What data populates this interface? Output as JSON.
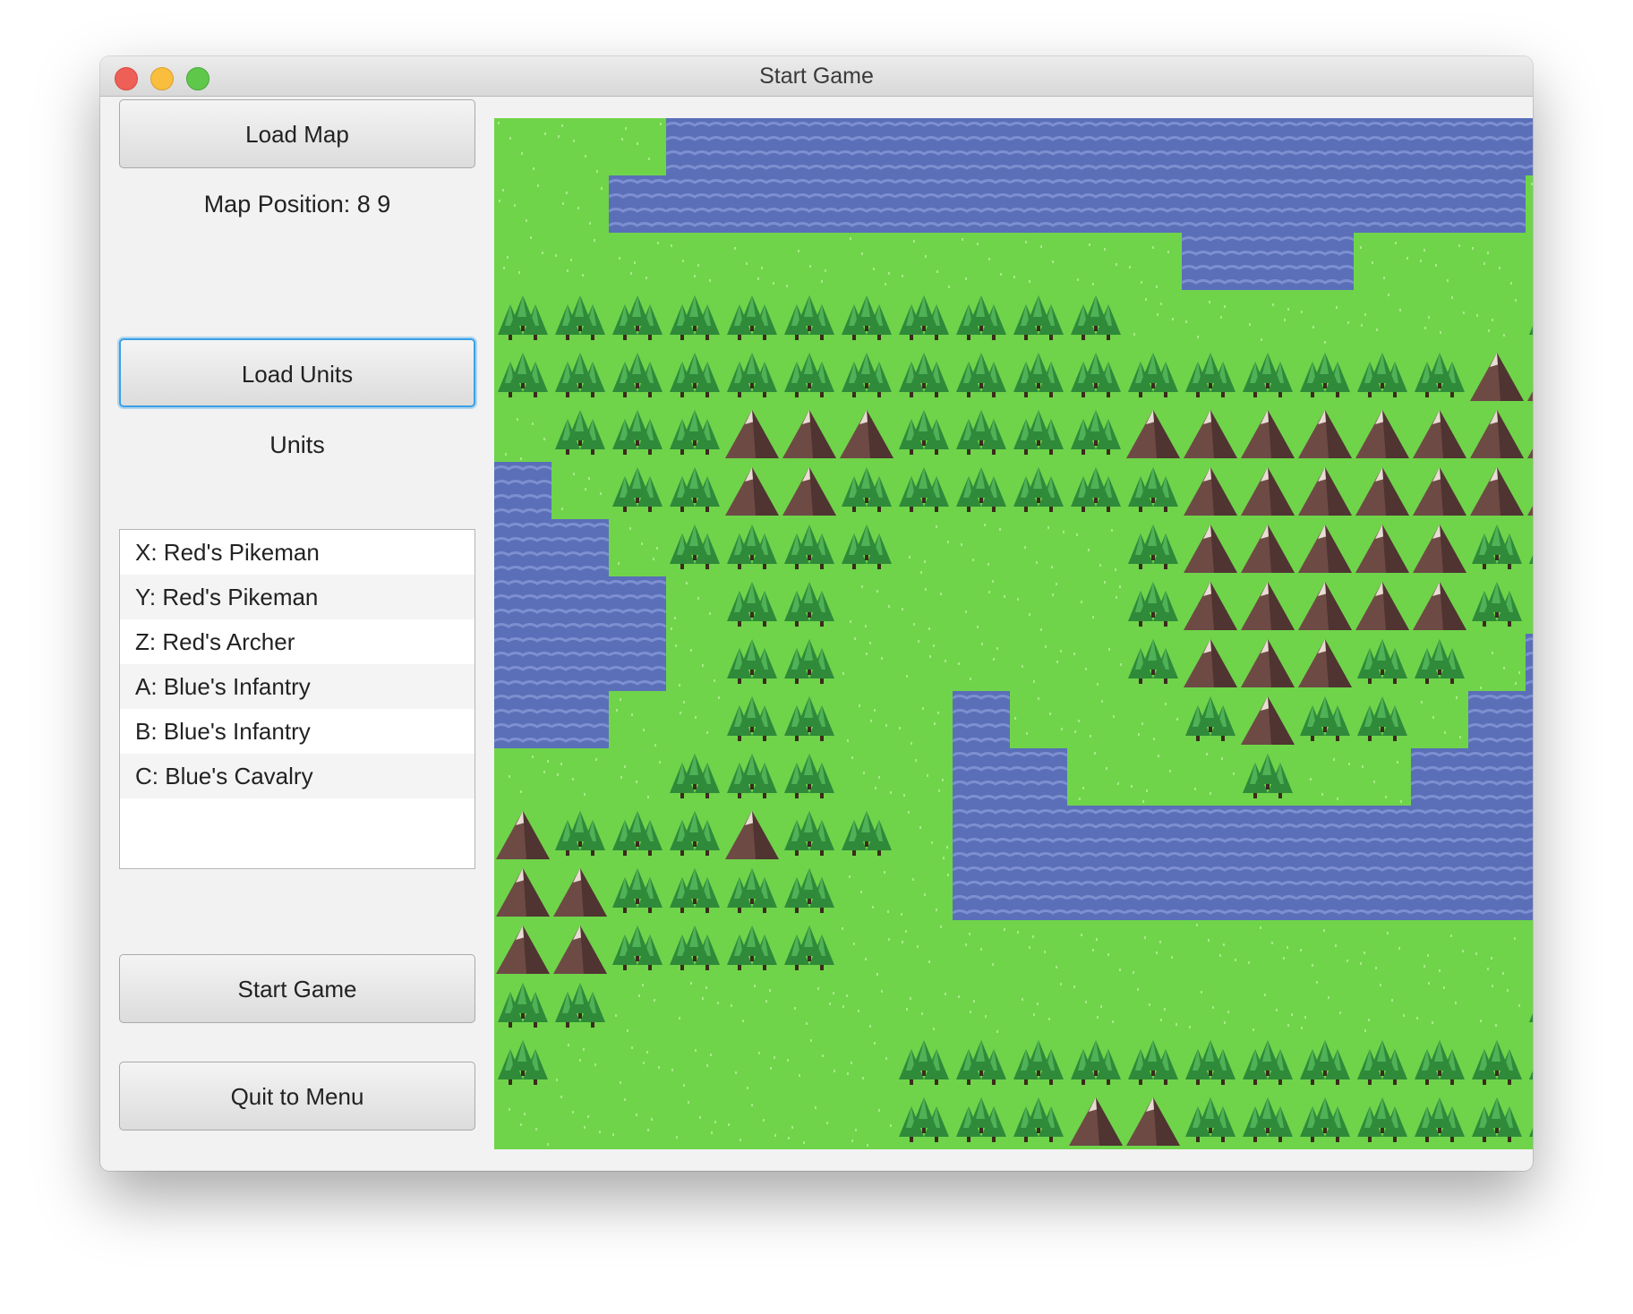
{
  "window": {
    "title": "Start Game"
  },
  "controls": {
    "load_map": "Load Map",
    "map_position": "Map Position: 8 9",
    "load_units": "Load Units",
    "units_heading": "Units",
    "start_game": "Start Game",
    "quit": "Quit to Menu"
  },
  "units": [
    "X: Red's Pikeman",
    "Y: Red's Pikeman",
    "Z: Red's Archer",
    "A: Blue's Infantry",
    "B: Blue's Infantry",
    "C: Blue's Cavalry"
  ],
  "map": {
    "legend": {
      "G": "grass",
      "W": "water",
      "F": "forest",
      "M": "mountain"
    },
    "colors": {
      "grass": "#6fd44a",
      "water": "#5a6fb8",
      "forest": "#2f8a3a",
      "mountain": "#6e4a45"
    },
    "rows": [
      "GGGWWWWWWWWWWWWWWWWG",
      "GGWWWWWWWWWWWWWWWWGG",
      "GGGGGGGGGGGGWWWGGGGF",
      "FFFFFFFFFFFGGGGGGGFM",
      "FFFFFFFFFFFFFFFFFMMM",
      "GFFFMMMFFFFMMMMMMMMM",
      "WGFFMMFFFFFFMMMMMMMM",
      "WWGFFFFGGGGFMMMMMFFF",
      "WWWGFFGGGGGFMMMMMFGG",
      "WWWGFFGGGGGFMMMFFGWG",
      "WWGGFFGGWGGGFMFFGWWW",
      "GGGFFFGGWWGGGFGGWWWW",
      "MFFFMFFGWWWWWWWWWWWW",
      "MMFFFFGGWWWWWWWWWWWW",
      "MMFFFFGGGGGGGGGGGGGG",
      "FFGGGGGGGGGGGGGGGGFG",
      "FGGGGGGFFFFFFFFFFFFF",
      "GGGGGGGFFFMMFFFFFFFF"
    ]
  }
}
